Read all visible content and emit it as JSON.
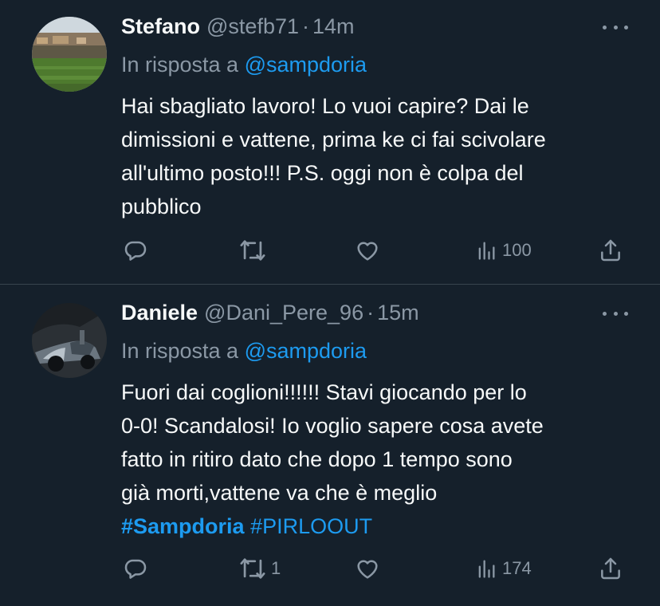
{
  "tweets": [
    {
      "name": "Stefano",
      "handle": "@stefb71",
      "separator": "·",
      "time": "14m",
      "reply_prefix": "In risposta a",
      "reply_mention": "@sampdoria",
      "lines": [
        "Hai sbagliato lavoro! Lo vuoi capire? Dai le",
        "dimissioni e vattene, prima ke ci fai scivolare",
        "all'ultimo posto!!! P.S. oggi non è colpa del",
        "pubblico"
      ],
      "actions": {
        "replies": "",
        "retweets": "",
        "likes": "",
        "views": "100"
      }
    },
    {
      "name": "Daniele",
      "handle": "@Dani_Pere_96",
      "separator": "·",
      "time": "15m",
      "reply_prefix": "In risposta a",
      "reply_mention": "@sampdoria",
      "lines": [
        "Fuori dai coglioni!!!!!! Stavi giocando per lo",
        "0-0! Scandalosi! Io voglio sapere cosa avete",
        "fatto in ritiro dato che dopo 1 tempo sono",
        "già morti,vattene va che è meglio"
      ],
      "hashtags": [
        "#Sampdoria",
        "#PIRLOOUT"
      ],
      "actions": {
        "replies": "",
        "retweets": "1",
        "likes": "",
        "views": "174"
      }
    }
  ],
  "icons": {
    "reply": "reply-icon",
    "retweet": "retweet-icon",
    "like": "heart-icon",
    "views": "views-icon",
    "share": "share-icon",
    "more": "more-icon"
  },
  "colors": {
    "background": "#15202b",
    "text": "#f7f9f9",
    "secondary": "#8b98a5",
    "accent": "#1d9bf0",
    "divider": "#38444d"
  }
}
